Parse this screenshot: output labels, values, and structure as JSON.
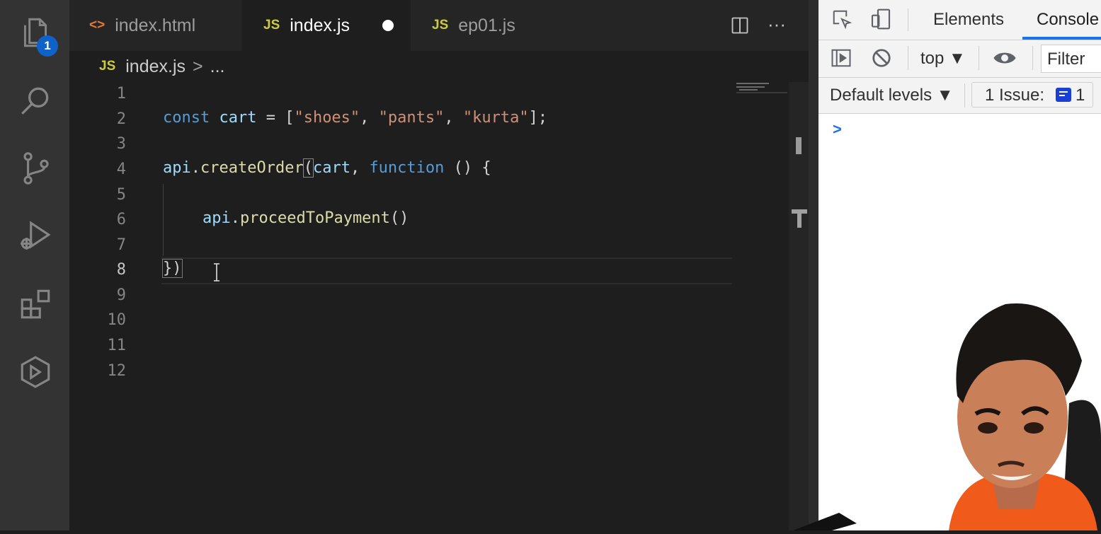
{
  "activity_bar": {
    "explorer_badge": "1"
  },
  "tabs": [
    {
      "icon": "<>",
      "label": "index.html"
    },
    {
      "icon": "JS",
      "label": "index.js"
    },
    {
      "icon": "JS",
      "label": "ep01.js"
    }
  ],
  "breadcrumb": {
    "icon": "JS",
    "file": "index.js",
    "separator": ">",
    "rest": "..."
  },
  "editor": {
    "line_numbers": [
      "1",
      "2",
      "3",
      "4",
      "5",
      "6",
      "7",
      "8",
      "9",
      "10",
      "11",
      "12"
    ],
    "current_line": 8,
    "lines": {
      "l2": {
        "kw": "const",
        "var": "cart",
        "eq": " = [",
        "s1": "\"shoes\"",
        "c1": ", ",
        "s2": "\"pants\"",
        "c2": ", ",
        "s3": "\"kurta\"",
        "end": "];"
      },
      "l4": {
        "obj": "api",
        "dot": ".",
        "fn": "createOrder",
        "open": "(",
        "arg": "cart",
        "comma": ", ",
        "kw": "function",
        "rest": " () {"
      },
      "l6": {
        "obj": "api",
        "dot": ".",
        "fn": "proceedToPayment",
        "rest": "()"
      },
      "l8": {
        "text": "})"
      }
    }
  },
  "devtools": {
    "tabs": [
      "Elements",
      "Console"
    ],
    "context": "top ▼",
    "filter_placeholder": "Filter",
    "levels": "Default levels ▼",
    "issues_label": "1 Issue:",
    "issues_count": "1",
    "prompt": ">"
  },
  "colors": {
    "js_icon": "#cbcb41",
    "html_icon": "#e37933",
    "badge": "#0e62c8",
    "devtools_accent": "#1a73e8"
  }
}
